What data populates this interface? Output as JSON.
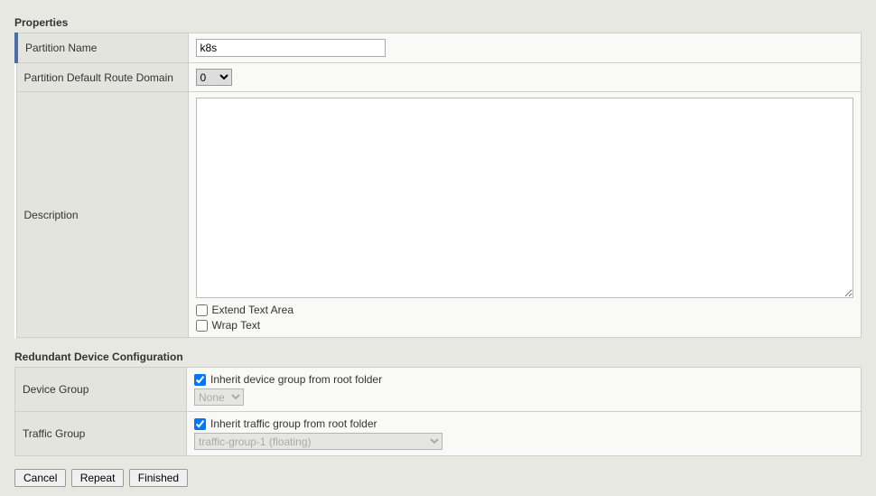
{
  "sections": {
    "properties": {
      "title": "Properties",
      "rows": {
        "partitionName": {
          "label": "Partition Name",
          "value": "k8s"
        },
        "routeDomain": {
          "label": "Partition Default Route Domain",
          "selected": "0"
        },
        "description": {
          "label": "Description",
          "value": "",
          "extendLabel": "Extend Text Area",
          "wrapLabel": "Wrap Text"
        }
      }
    },
    "redundant": {
      "title": "Redundant Device Configuration",
      "rows": {
        "deviceGroup": {
          "label": "Device Group",
          "inheritLabel": "Inherit device group from root folder",
          "selected": "None"
        },
        "trafficGroup": {
          "label": "Traffic Group",
          "inheritLabel": "Inherit traffic group from root folder",
          "selected": "traffic-group-1 (floating)"
        }
      }
    }
  },
  "buttons": {
    "cancel": "Cancel",
    "repeat": "Repeat",
    "finished": "Finished"
  }
}
